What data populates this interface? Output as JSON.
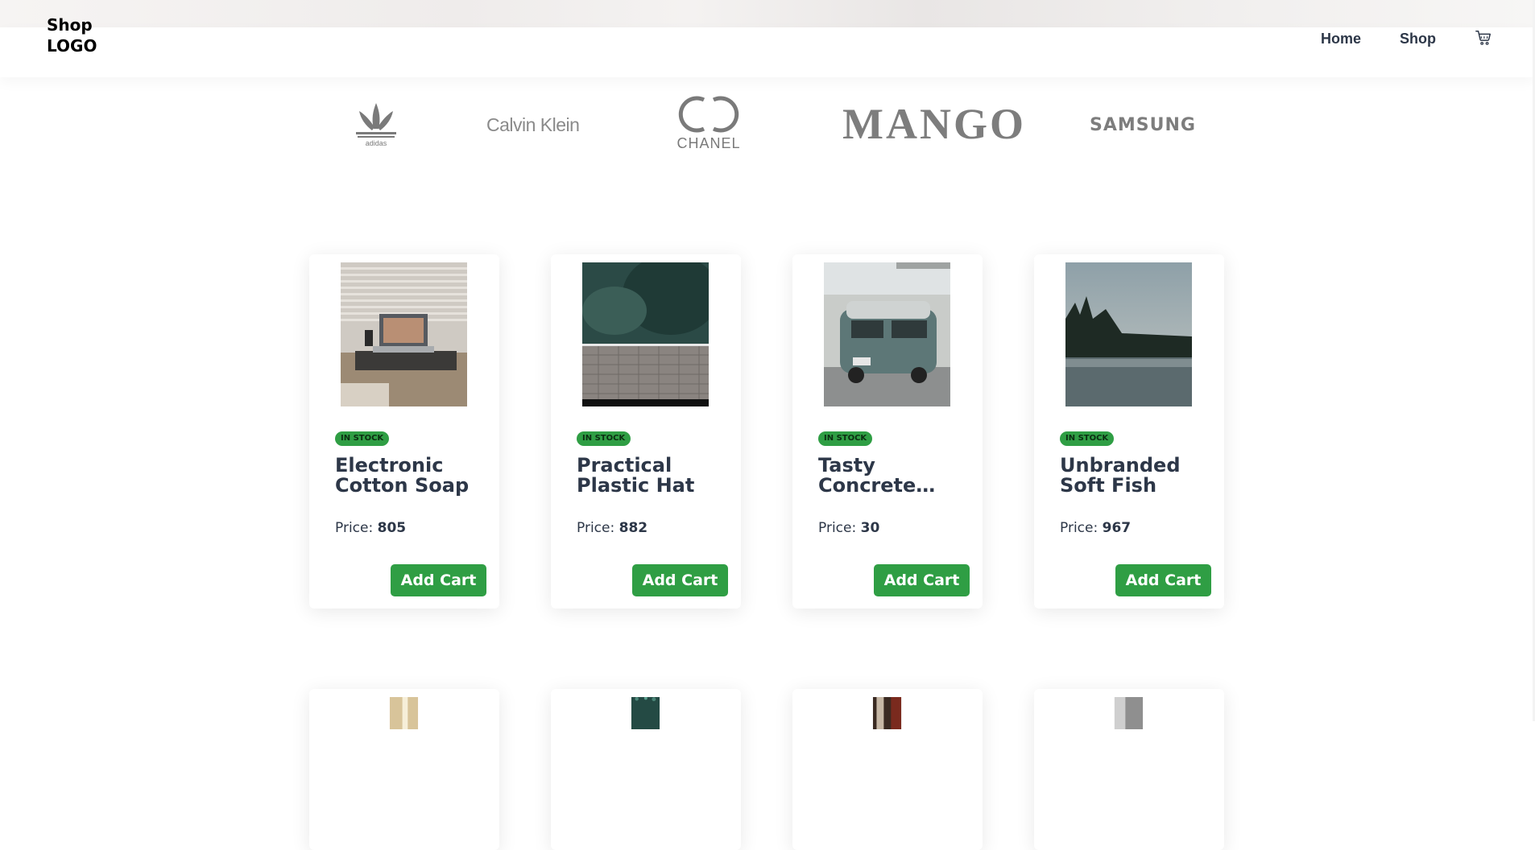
{
  "logo": {
    "line1": "Shop",
    "line2": "LOGO"
  },
  "nav": {
    "home": "Home",
    "shop": "Shop",
    "cart_icon": "cart-icon"
  },
  "brands": {
    "adidas": "adidas",
    "calvin_klein": "Calvin Klein",
    "chanel": "CHANEL",
    "mango": "MANGO",
    "samsung": "SAMSUNG"
  },
  "products": [
    {
      "stock": "IN STOCK",
      "title": "Electronic Cotton Soap",
      "price_label": "Price:",
      "price": "805",
      "button": "Add Cart"
    },
    {
      "stock": "IN STOCK",
      "title": "Practical Plastic Hat",
      "price_label": "Price:",
      "price": "882",
      "button": "Add Cart"
    },
    {
      "stock": "IN STOCK",
      "title": "Tasty Concrete…",
      "price_label": "Price:",
      "price": "30",
      "button": "Add Cart"
    },
    {
      "stock": "IN STOCK",
      "title": "Unbranded Soft Fish",
      "price_label": "Price:",
      "price": "967",
      "button": "Add Cart"
    }
  ],
  "colors": {
    "accent": "#2f9e44",
    "text": "#2d3748",
    "brand_gray": "#7d7d7d"
  }
}
